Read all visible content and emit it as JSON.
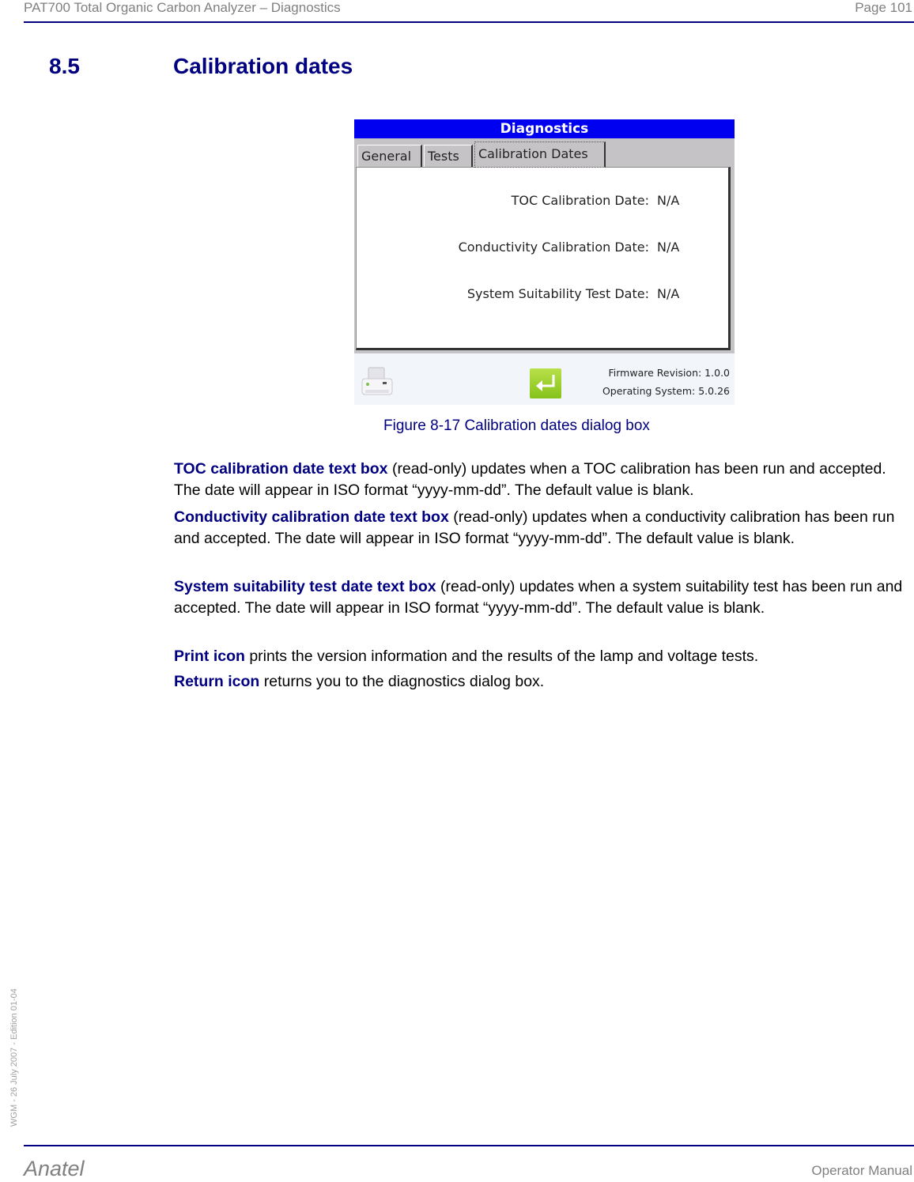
{
  "header": {
    "title": "PAT700 Total Organic Carbon Analyzer – Diagnostics",
    "page": "Page 101"
  },
  "section": {
    "number": "8.5",
    "title": "Calibration dates"
  },
  "figure": {
    "dialog_title": "Diagnostics",
    "tabs": [
      {
        "label": "General",
        "active": false
      },
      {
        "label": "Tests",
        "active": false
      },
      {
        "label": "Calibration Dates",
        "active": true
      }
    ],
    "rows": [
      {
        "label": "TOC Calibration Date:",
        "value": "N/A"
      },
      {
        "label": "Conductivity Calibration Date:",
        "value": "N/A"
      },
      {
        "label": "System Suitability Test Date:",
        "value": "N/A"
      }
    ],
    "icons": {
      "print": "printer-icon",
      "return": "return-arrow-icon"
    },
    "firmware_revision": "Firmware Revision: 1.0.0",
    "operating_system": "Operating System: 5.0.26",
    "caption": "Figure 8-17 Calibration dates dialog box"
  },
  "paragraphs": [
    {
      "term": "TOC calibration date text box",
      "text": " (read-only) updates when a TOC calibration has been run and accepted. The date will appear in ISO format “yyyy-mm-dd”. The default value is blank."
    },
    {
      "term": "Conductivity calibration date text box",
      "text": " (read-only) updates when a conductivity calibration has been run and accepted. The date will appear in ISO format “yyyy-mm-dd”. The default value is blank."
    },
    {
      "term": "System suitability test date text box",
      "text": " (read-only) updates when a system suitability test has been run and accepted. The date will appear in ISO format “yyyy-mm-dd”. The default value is blank."
    },
    {
      "term": "Print icon",
      "text": " prints the version information and the results of the lamp and voltage tests."
    },
    {
      "term": "Return icon",
      "text": " returns you to the diagnostics dialog box."
    }
  ],
  "side_mark": "WGM - 26 July 2007 - Edition 01-04",
  "footer": {
    "brand": "Anatel",
    "doc": "Operator Manual"
  },
  "colors": {
    "accent": "#000080",
    "dialog_title_bar": "#0000f0",
    "muted": "#808080"
  }
}
